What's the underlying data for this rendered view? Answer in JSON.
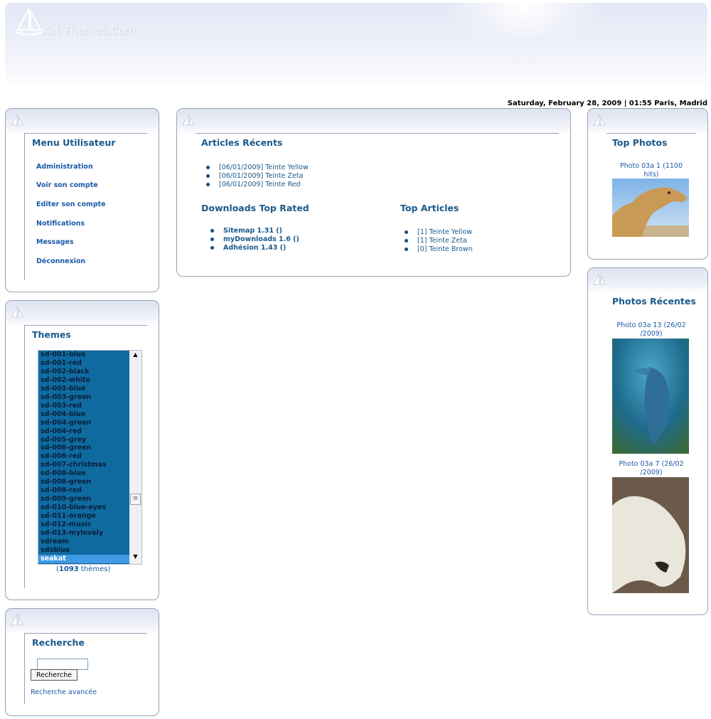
{
  "header": {
    "logo_text": "Kat Themes.Com"
  },
  "datebar": {
    "text": "Saturday, February 28, 2009 | 01:55 Paris, Madrid"
  },
  "user_menu": {
    "title": "Menu Utilisateur",
    "items": [
      "Administration",
      "Voir son compte",
      "Editer son compte",
      "Notifications",
      "Messages",
      "Déconnexion"
    ]
  },
  "themes": {
    "title": "Themes",
    "items": [
      "sd-001-blue",
      "sd-001-red",
      "sd-002-black",
      "sd-002-white",
      "sd-003-blue",
      "sd-003-green",
      "sd-003-red",
      "sd-004-blue",
      "sd-004-green",
      "sd-004-red",
      "sd-005-grey",
      "sd-006-green",
      "sd-006-red",
      "sd-007-christmas",
      "sd-008-blue",
      "sd-008-green",
      "sd-008-red",
      "sd-009-green",
      "sd-010-blue-eyes",
      "sd-011-orange",
      "sd-012-music",
      "sd-013-mylovely",
      "sdream",
      "sdsblue",
      "seakat"
    ],
    "selected": "seakat",
    "count_open": "(",
    "count": "1093",
    "count_suffix": " thèmes)"
  },
  "search": {
    "title": "Recherche",
    "input_value": "",
    "button_label": "Recherche",
    "advanced_label": "Recherche avancée"
  },
  "articles": {
    "title": "Articles Récents",
    "items": [
      {
        "date": "[06/01/2009]",
        "name": "Teinte Yellow"
      },
      {
        "date": "[06/01/2009]",
        "name": "Teinte Zeta"
      },
      {
        "date": "[06/01/2009]",
        "name": "Teinte Red"
      }
    ]
  },
  "downloads": {
    "title": "Downloads Top Rated",
    "items": [
      "Sitemap 1.31 ()",
      "myDownloads 1.6 ()",
      "Adhésion 1.43 ()"
    ]
  },
  "top_articles": {
    "title": "Top Articles",
    "items": [
      {
        "count": "[1]",
        "name": "Teinte Yellow"
      },
      {
        "count": "[1]",
        "name": "Teinte Zeta"
      },
      {
        "count": "[0]",
        "name": "Teinte Brown"
      }
    ]
  },
  "top_photos": {
    "title": "Top Photos",
    "items": [
      {
        "caption": "Photo 03a 1 (1100 hits)"
      }
    ]
  },
  "recent_photos": {
    "title": "Photos Récentes",
    "items": [
      {
        "caption": "Photo 03a 13 (26/02 /2009)"
      },
      {
        "caption": "Photo 03a 7 (26/02 /2009)"
      }
    ]
  }
}
